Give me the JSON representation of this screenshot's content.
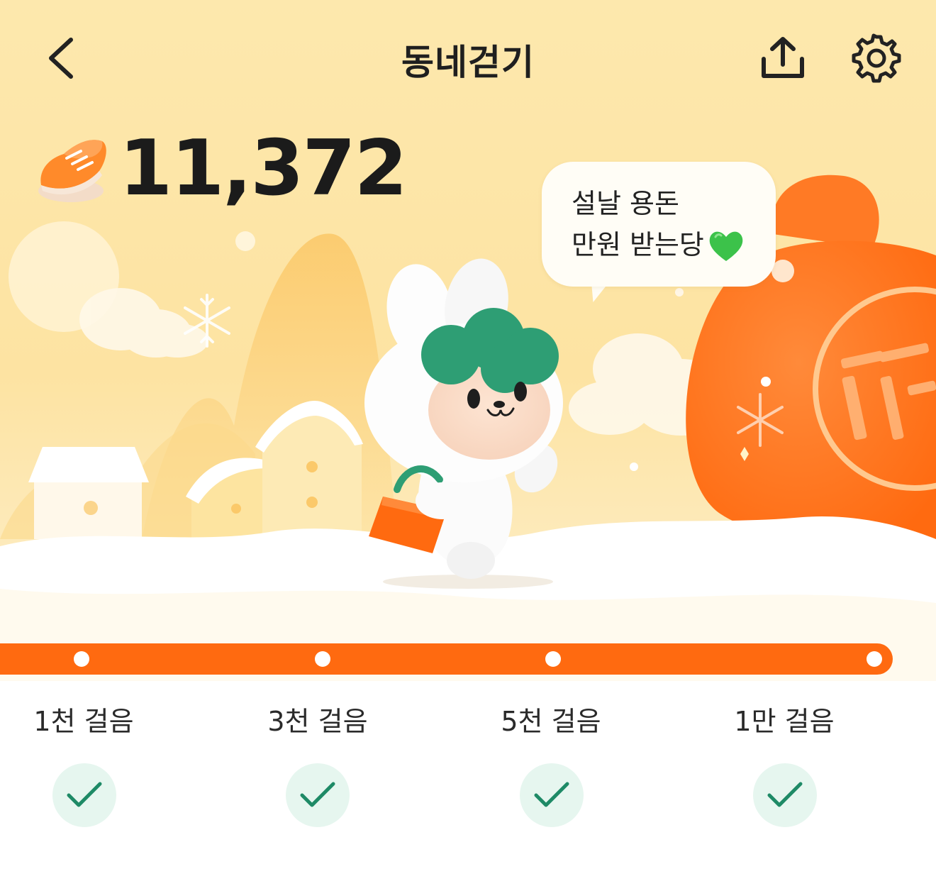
{
  "header": {
    "title": "동네걷기",
    "back_icon": "chevron-left-icon",
    "share_icon": "share-upload-icon",
    "settings_icon": "gear-icon"
  },
  "steps": {
    "count": "11,372",
    "icon": "sneaker-icon"
  },
  "bubble": {
    "line1": "설날 용돈",
    "line2": "만원 받는당",
    "emoji": "green-heart-icon"
  },
  "progress": {
    "fill_fraction": 1.0,
    "milestones": [
      {
        "label": "1천 걸음",
        "done": true
      },
      {
        "label": "3천 걸음",
        "done": true
      },
      {
        "label": "5천 걸음",
        "done": true
      },
      {
        "label": "1만 걸음",
        "done": true
      }
    ]
  },
  "colors": {
    "accent": "#ff6a10",
    "sky": "#fde6a8",
    "check_bg": "#e6f6ef",
    "check": "#1e8a66"
  }
}
